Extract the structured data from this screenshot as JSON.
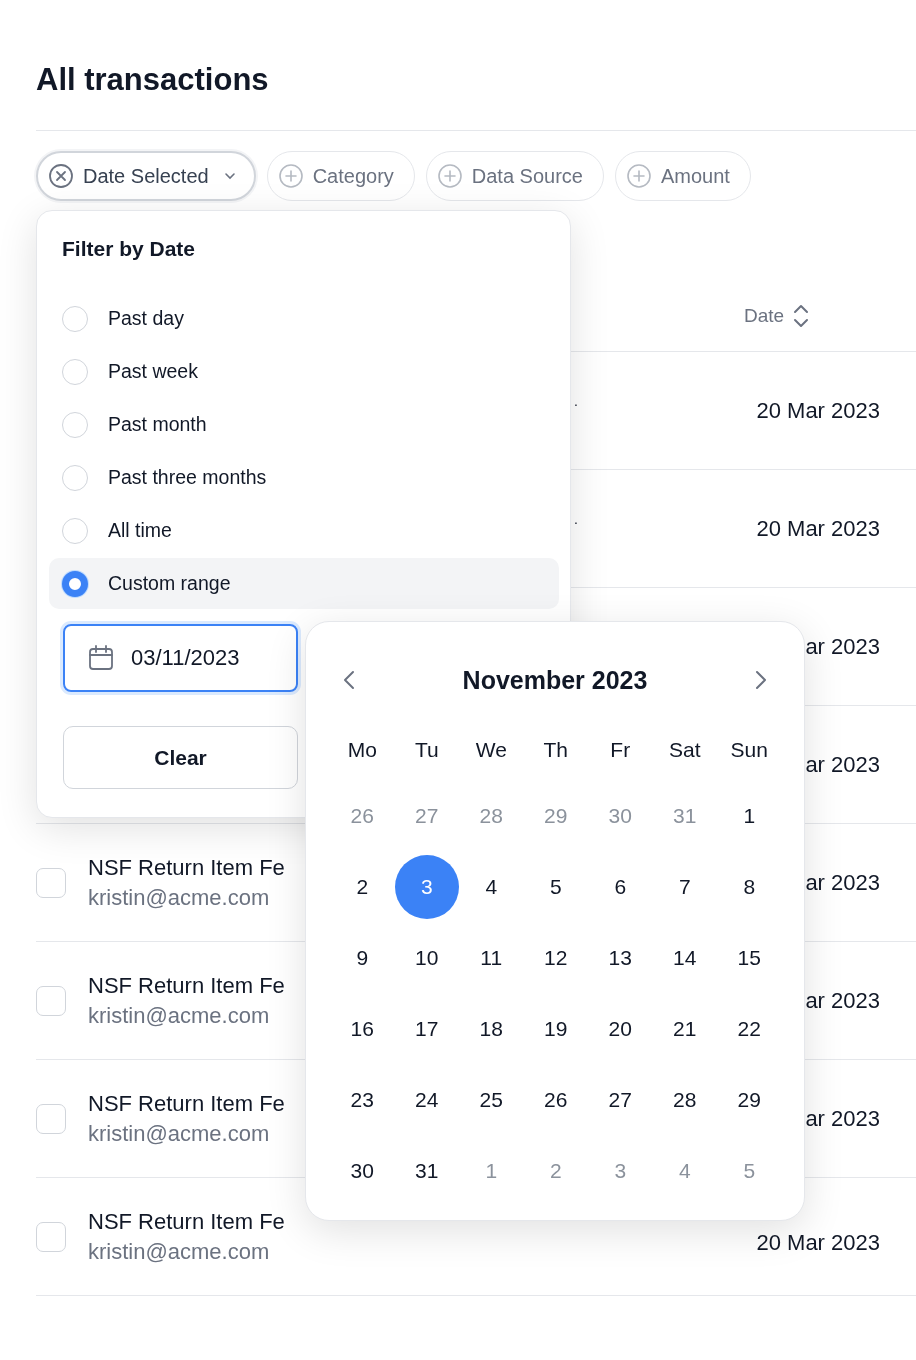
{
  "page": {
    "title": "All transactions"
  },
  "filters": [
    {
      "label": "Date Selected",
      "kind": "active"
    },
    {
      "label": "Category",
      "kind": "add"
    },
    {
      "label": "Data Source",
      "kind": "add"
    },
    {
      "label": "Amount",
      "kind": "add"
    }
  ],
  "table": {
    "columns": [
      {
        "label": "Date"
      }
    ],
    "rows": [
      {
        "column_2": ".",
        "date": "20 Mar 2023"
      },
      {
        "column_2": ".",
        "date": "20 Mar 2023"
      },
      {
        "date": "ar 2023"
      },
      {
        "date": "ar 2023"
      },
      {
        "checked": false,
        "name": "NSF Return Item Fe",
        "email": "kristin@acme.com",
        "date": "ar 2023"
      },
      {
        "checked": false,
        "name": "NSF Return Item Fe",
        "email": "kristin@acme.com",
        "date": "ar 2023"
      },
      {
        "checked": false,
        "name": "NSF Return Item Fe",
        "email": "kristin@acme.com",
        "date": "ar 2023"
      },
      {
        "checked": false,
        "name": "NSF Return Item Fe",
        "email": "kristin@acme.com",
        "date": "20 Mar 2023"
      }
    ]
  },
  "date_filter": {
    "title": "Filter by Date",
    "options": [
      {
        "label": "Past day",
        "selected": false
      },
      {
        "label": "Past week",
        "selected": false
      },
      {
        "label": "Past month",
        "selected": false
      },
      {
        "label": "Past three months",
        "selected": false
      },
      {
        "label": "All time",
        "selected": false
      },
      {
        "label": "Custom range",
        "selected": true
      }
    ],
    "date_input": {
      "value": "03/11/2023"
    },
    "clear_button": "Clear"
  },
  "calendar": {
    "month_label": "November 2023",
    "weekdays": [
      "Mo",
      "Tu",
      "We",
      "Th",
      "Fr",
      "Sat",
      "Sun"
    ],
    "days": [
      {
        "label": "26",
        "kind": "outside",
        "selected": false
      },
      {
        "label": "27",
        "kind": "outside",
        "selected": false
      },
      {
        "label": "28",
        "kind": "outside",
        "selected": false
      },
      {
        "label": "29",
        "kind": "outside",
        "selected": false
      },
      {
        "label": "30",
        "kind": "outside",
        "selected": false
      },
      {
        "label": "31",
        "kind": "outside",
        "selected": false
      },
      {
        "label": "1",
        "kind": "current",
        "selected": false
      },
      {
        "label": "2",
        "kind": "current",
        "selected": false
      },
      {
        "label": "3",
        "kind": "current",
        "selected": true
      },
      {
        "label": "4",
        "kind": "current",
        "selected": false
      },
      {
        "label": "5",
        "kind": "current",
        "selected": false
      },
      {
        "label": "6",
        "kind": "current",
        "selected": false
      },
      {
        "label": "7",
        "kind": "current",
        "selected": false
      },
      {
        "label": "8",
        "kind": "current",
        "selected": false
      },
      {
        "label": "9",
        "kind": "current",
        "selected": false
      },
      {
        "label": "10",
        "kind": "current",
        "selected": false
      },
      {
        "label": "11",
        "kind": "current",
        "selected": false
      },
      {
        "label": "12",
        "kind": "current",
        "selected": false
      },
      {
        "label": "13",
        "kind": "current",
        "selected": false
      },
      {
        "label": "14",
        "kind": "current",
        "selected": false
      },
      {
        "label": "15",
        "kind": "current",
        "selected": false
      },
      {
        "label": "16",
        "kind": "current",
        "selected": false
      },
      {
        "label": "17",
        "kind": "current",
        "selected": false
      },
      {
        "label": "18",
        "kind": "current",
        "selected": false
      },
      {
        "label": "19",
        "kind": "current",
        "selected": false
      },
      {
        "label": "20",
        "kind": "current",
        "selected": false
      },
      {
        "label": "21",
        "kind": "current",
        "selected": false
      },
      {
        "label": "22",
        "kind": "current",
        "selected": false
      },
      {
        "label": "23",
        "kind": "current",
        "selected": false
      },
      {
        "label": "24",
        "kind": "current",
        "selected": false
      },
      {
        "label": "25",
        "kind": "current",
        "selected": false
      },
      {
        "label": "26",
        "kind": "current",
        "selected": false
      },
      {
        "label": "27",
        "kind": "current",
        "selected": false
      },
      {
        "label": "28",
        "kind": "current",
        "selected": false
      },
      {
        "label": "29",
        "kind": "current",
        "selected": false
      },
      {
        "label": "30",
        "kind": "current",
        "selected": false
      },
      {
        "label": "31",
        "kind": "current",
        "selected": false
      },
      {
        "label": "1",
        "kind": "outside",
        "selected": false
      },
      {
        "label": "2",
        "kind": "outside",
        "selected": false
      },
      {
        "label": "3",
        "kind": "outside",
        "selected": false
      },
      {
        "label": "4",
        "kind": "outside",
        "selected": false
      },
      {
        "label": "5",
        "kind": "outside",
        "selected": false
      }
    ]
  }
}
